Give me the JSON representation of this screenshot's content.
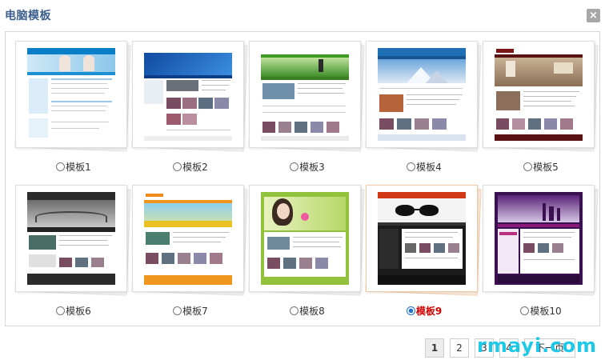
{
  "dialog": {
    "title": "电脑模板",
    "close_icon": "×"
  },
  "templates": [
    {
      "label": "模板1",
      "selected": false
    },
    {
      "label": "模板2",
      "selected": false
    },
    {
      "label": "模板3",
      "selected": false
    },
    {
      "label": "模板4",
      "selected": false
    },
    {
      "label": "模板5",
      "selected": false
    },
    {
      "label": "模板6",
      "selected": false
    },
    {
      "label": "模板7",
      "selected": false
    },
    {
      "label": "模板8",
      "selected": false
    },
    {
      "label": "模板9",
      "selected": true
    },
    {
      "label": "模板10",
      "selected": false
    }
  ],
  "pagination": {
    "pages": [
      "1",
      "2",
      "3",
      "4",
      "下一页"
    ],
    "current": "1"
  },
  "watermark": "rmayi.com",
  "colors": {
    "title": "#3d5f8c",
    "selected_label": "#d40000",
    "watermark": "#1ec9e8"
  }
}
